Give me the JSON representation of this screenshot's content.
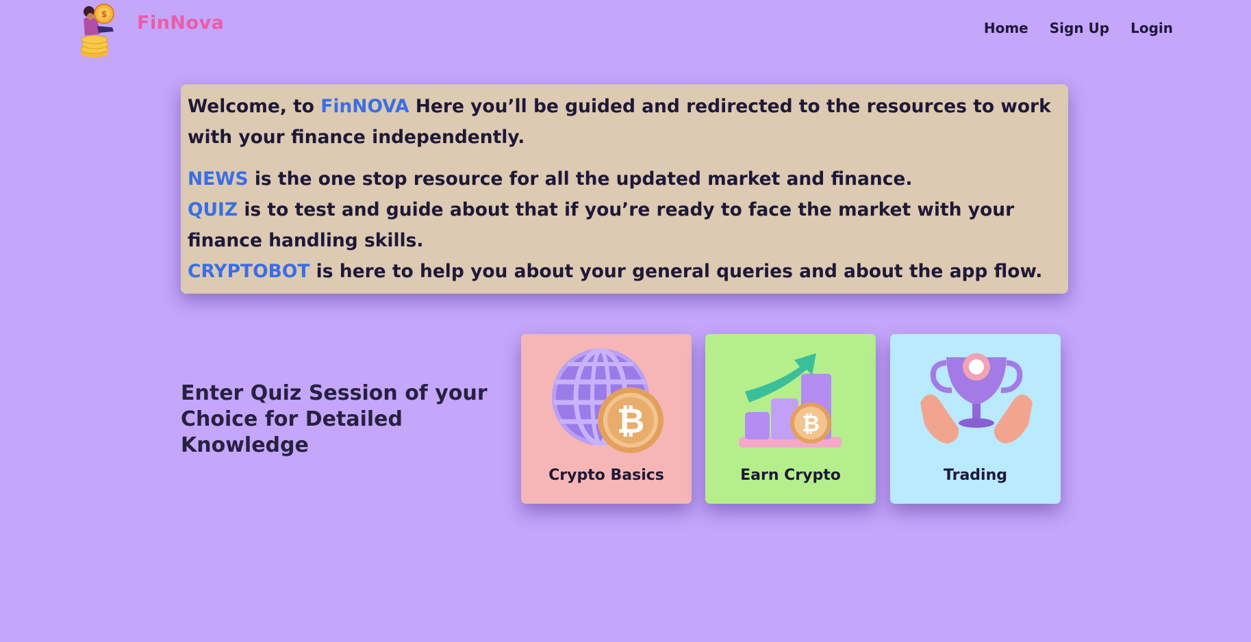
{
  "header": {
    "logo_icon": "coin-person-logo-icon",
    "brand": "FinNova",
    "brand_color": "#ec5ca8",
    "nav": [
      {
        "label": "Home"
      },
      {
        "label": "Sign Up"
      },
      {
        "label": "Login"
      }
    ]
  },
  "intro": {
    "welcome_prefix": "Welcome, to ",
    "welcome_brand": "FinNOVA",
    "welcome_rest": " Here you’ll be guided and redirected to the resources to work with your finance independently.",
    "news_key": "NEWS",
    "news_text": " is the one stop resource for all the updated market and finance.",
    "quiz_key": "QUIZ",
    "quiz_text": " is to test and guide about that if you’re ready to face the market with your finance handling skills.",
    "bot_key": "CRYPTOBOT",
    "bot_text": " is here to help you about your general queries and about the app flow.",
    "highlight_color": "#3b6ee6",
    "background_color": "#dccab2"
  },
  "quiz": {
    "heading": "Enter Quiz Session of your Choice for Detailed Knowledge",
    "cards": [
      {
        "label": "Crypto Basics",
        "icon": "globe-bitcoin-icon",
        "color": "#f7b6b6"
      },
      {
        "label": "Earn Crypto",
        "icon": "growth-chart-bitcoin-icon",
        "color": "#b5ef8c"
      },
      {
        "label": "Trading",
        "icon": "trophy-hands-icon",
        "color": "#b9eaff"
      }
    ]
  },
  "page_background": "#c4a6fb"
}
